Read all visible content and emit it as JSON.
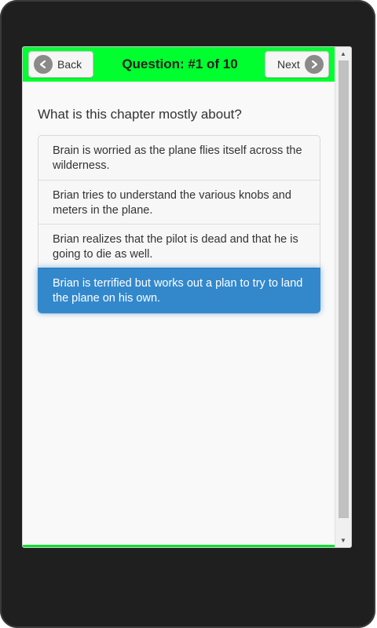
{
  "header": {
    "back_label": "Back",
    "next_label": "Next",
    "title": "Question: #1 of 10",
    "bg_color": "#00ff2e"
  },
  "question": "What is this chapter mostly about?",
  "answers": [
    {
      "text": "Brain is worried as the plane flies itself across the wilderness.",
      "selected": false
    },
    {
      "text": "Brian tries to understand the various knobs and meters in the plane.",
      "selected": false
    },
    {
      "text": "Brian realizes that the pilot is dead and that he is going to die as well.",
      "selected": false
    },
    {
      "text": "Brian is terrified but works out a plan to try to land the plane on his own.",
      "selected": true
    }
  ],
  "selected_color": "#3388cc",
  "icons": {
    "back": "arrow-left-circle-icon",
    "next": "arrow-right-circle-icon",
    "scroll_up": "triangle-up-icon",
    "scroll_down": "triangle-down-icon"
  }
}
